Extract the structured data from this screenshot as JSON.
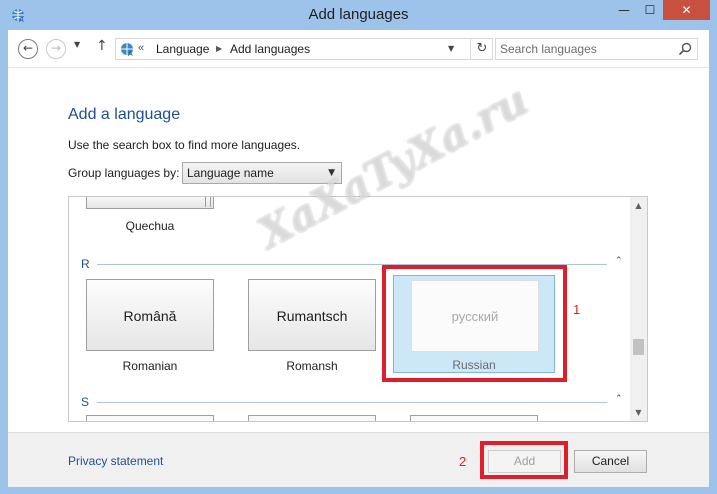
{
  "window": {
    "title": "Add languages",
    "minimize_glyph": "—",
    "maximize_glyph": "☐",
    "close_glyph": "✕"
  },
  "nav": {
    "back_glyph": "←",
    "forward_glyph": "→",
    "history_glyph": "▼",
    "up_glyph": "↑",
    "address_chevron": "«",
    "breadcrumbs": [
      "Language",
      "Add languages"
    ],
    "crumb_separator": "▶",
    "address_drop_glyph": "▼",
    "refresh_glyph": "↻",
    "search_placeholder": "Search languages"
  },
  "main": {
    "heading": "Add a language",
    "help_text": "Use the search box to find more languages.",
    "group_label": "Group languages by:",
    "group_value": "Language name",
    "group_arrow": "▼"
  },
  "list": {
    "scroll_up": "▲",
    "scroll_down": "▼",
    "partial_tile_caption": "Quechua",
    "sections": [
      {
        "letter": "R",
        "chevron": "⌃",
        "tiles": [
          {
            "native": "Română",
            "caption": "Romanian"
          },
          {
            "native": "Rumantsch",
            "caption": "Romansh"
          }
        ],
        "selected_tile": {
          "native": "русский",
          "caption": "Russian"
        }
      },
      {
        "letter": "S",
        "chevron": "⌃"
      }
    ]
  },
  "footer": {
    "privacy_link": "Privacy statement",
    "add_label": "Add",
    "cancel_label": "Cancel"
  },
  "annotations": {
    "label_1": "1",
    "label_2": "2",
    "color": "#e01e2b"
  },
  "watermark": "XaXaTyXa.ru",
  "colors": {
    "frame": "#9ec3ea",
    "close_button": "#c7503f",
    "heading": "#1f4e99",
    "selection": "#cce8f7"
  }
}
